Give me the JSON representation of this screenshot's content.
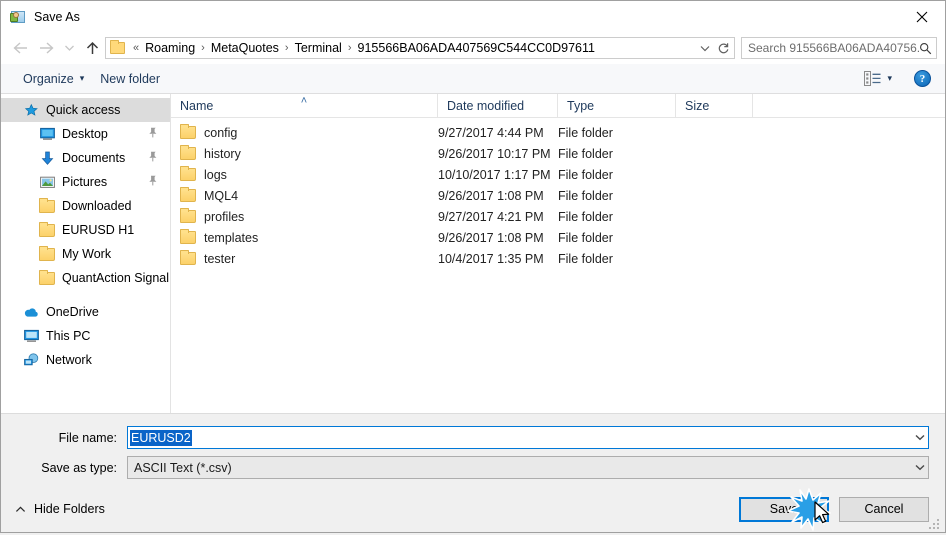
{
  "window": {
    "title": "Save As",
    "icon": "save-as-icon",
    "close_label": "✕"
  },
  "nav": {
    "back_icon": "back-arrow-icon",
    "forward_icon": "forward-arrow-icon",
    "recent_icon": "recent-locations-chevron-icon",
    "up_icon": "up-arrow-icon",
    "address": {
      "folder_icon": "folder-icon",
      "overflow": "«",
      "crumbs": [
        "Roaming",
        "MetaQuotes",
        "Terminal",
        "915566BA06ADA407569C544CC0D97611"
      ],
      "separator": "›",
      "dropdown_icon": "chevron-down-icon",
      "refresh_icon": "refresh-icon"
    },
    "search": {
      "placeholder": "Search 915566BA06ADA40756...",
      "icon": "search-icon"
    }
  },
  "toolbar": {
    "organize_label": "Organize",
    "organize_caret": "▾",
    "new_folder_label": "New folder",
    "view_icon": "view-layout-icon",
    "view_caret": "▾",
    "help_label": "?"
  },
  "sidebar": {
    "items": [
      {
        "label": "Quick access",
        "icon": "star-pin-icon",
        "selected": true,
        "indent": false,
        "pinned": false
      },
      {
        "label": "Desktop",
        "icon": "desktop-icon",
        "selected": false,
        "indent": true,
        "pinned": true
      },
      {
        "label": "Documents",
        "icon": "documents-icon",
        "selected": false,
        "indent": true,
        "pinned": true
      },
      {
        "label": "Pictures",
        "icon": "pictures-icon",
        "selected": false,
        "indent": true,
        "pinned": true
      },
      {
        "label": "Downloaded",
        "icon": "folder-icon",
        "selected": false,
        "indent": true,
        "pinned": false
      },
      {
        "label": "EURUSD H1",
        "icon": "folder-icon",
        "selected": false,
        "indent": true,
        "pinned": false
      },
      {
        "label": "My Work",
        "icon": "folder-icon",
        "selected": false,
        "indent": true,
        "pinned": false
      },
      {
        "label": "QuantAction Signal",
        "icon": "folder-icon",
        "selected": false,
        "indent": true,
        "pinned": false
      }
    ],
    "groups": [
      {
        "label": "OneDrive",
        "icon": "onedrive-icon"
      },
      {
        "label": "This PC",
        "icon": "this-pc-icon"
      },
      {
        "label": "Network",
        "icon": "network-icon"
      }
    ]
  },
  "filelist": {
    "columns": [
      "Name",
      "Date modified",
      "Type",
      "Size"
    ],
    "sort_column": "Name",
    "sort_caret": "˄",
    "rows": [
      {
        "name": "config",
        "date": "9/27/2017 4:44 PM",
        "type": "File folder",
        "size": ""
      },
      {
        "name": "history",
        "date": "9/26/2017 10:17 PM",
        "type": "File folder",
        "size": ""
      },
      {
        "name": "logs",
        "date": "10/10/2017 1:17 PM",
        "type": "File folder",
        "size": ""
      },
      {
        "name": "MQL4",
        "date": "9/26/2017 1:08 PM",
        "type": "File folder",
        "size": ""
      },
      {
        "name": "profiles",
        "date": "9/27/2017 4:21 PM",
        "type": "File folder",
        "size": ""
      },
      {
        "name": "templates",
        "date": "9/26/2017 1:08 PM",
        "type": "File folder",
        "size": ""
      },
      {
        "name": "tester",
        "date": "10/4/2017 1:35 PM",
        "type": "File folder",
        "size": ""
      }
    ]
  },
  "form": {
    "filename_label": "File name:",
    "filename_value": "EURUSD2",
    "filetype_label": "Save as type:",
    "filetype_value": "ASCII Text (*.csv)",
    "dropdown_icon": "chevron-down-icon"
  },
  "footer": {
    "hide_folders_label": "Hide Folders",
    "hide_folders_caret": "˄",
    "save_label": "Save",
    "cancel_label": "Cancel"
  },
  "colors": {
    "accent": "#0078d7",
    "selection": "#0a64c8",
    "folder": "#ffd96a",
    "header_text": "#1e395b"
  }
}
